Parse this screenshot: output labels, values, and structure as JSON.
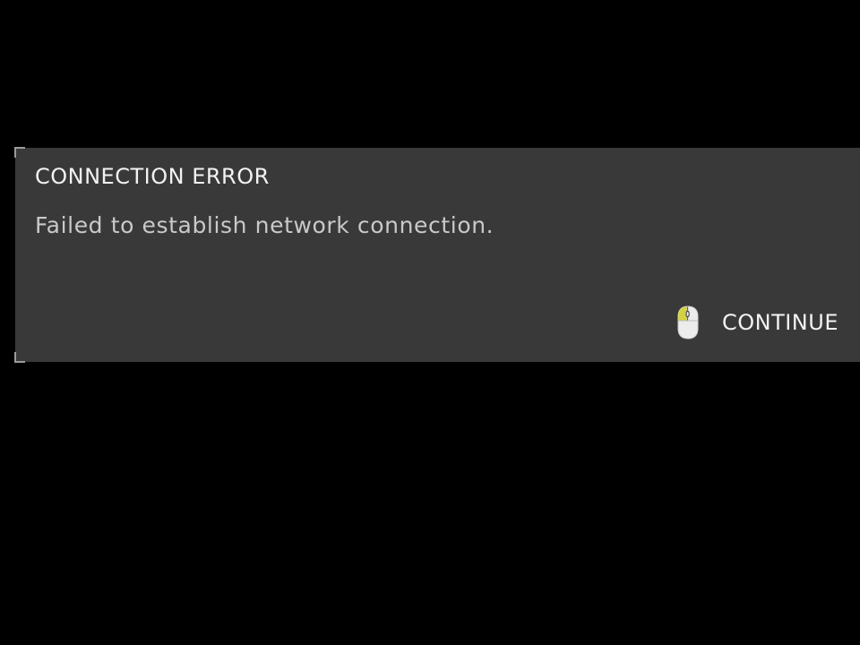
{
  "dialog": {
    "title": "CONNECTION ERROR",
    "message": "Failed to establish network connection.",
    "continue_label": "CONTINUE",
    "continue_icon": "mouse-left-click-icon"
  },
  "colors": {
    "background": "#000000",
    "panel": "#3a3939",
    "title_text": "#f2f2f2",
    "message_text": "#c9c9c9",
    "mouse_accent": "#d4d23a"
  }
}
